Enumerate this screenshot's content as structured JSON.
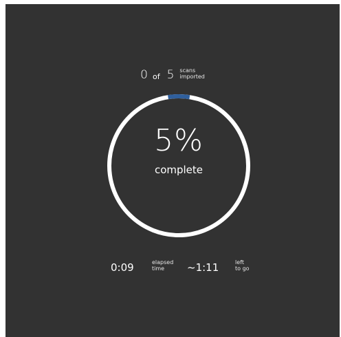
{
  "import": {
    "imported_count": "0",
    "of_label": "of",
    "total_count": "5",
    "unit_line1": "scans",
    "unit_line2": "imported"
  },
  "progress": {
    "percent_value": 5,
    "percent_text": "5%",
    "complete_label": "complete",
    "ring_color": "#ffffff",
    "fill_color": "#2f5f9d"
  },
  "timing": {
    "elapsed_value": "0:09",
    "elapsed_line1": "elapsed",
    "elapsed_line2": "time",
    "remaining_value": "~1:11",
    "remaining_line1": "left",
    "remaining_line2": "to go"
  }
}
